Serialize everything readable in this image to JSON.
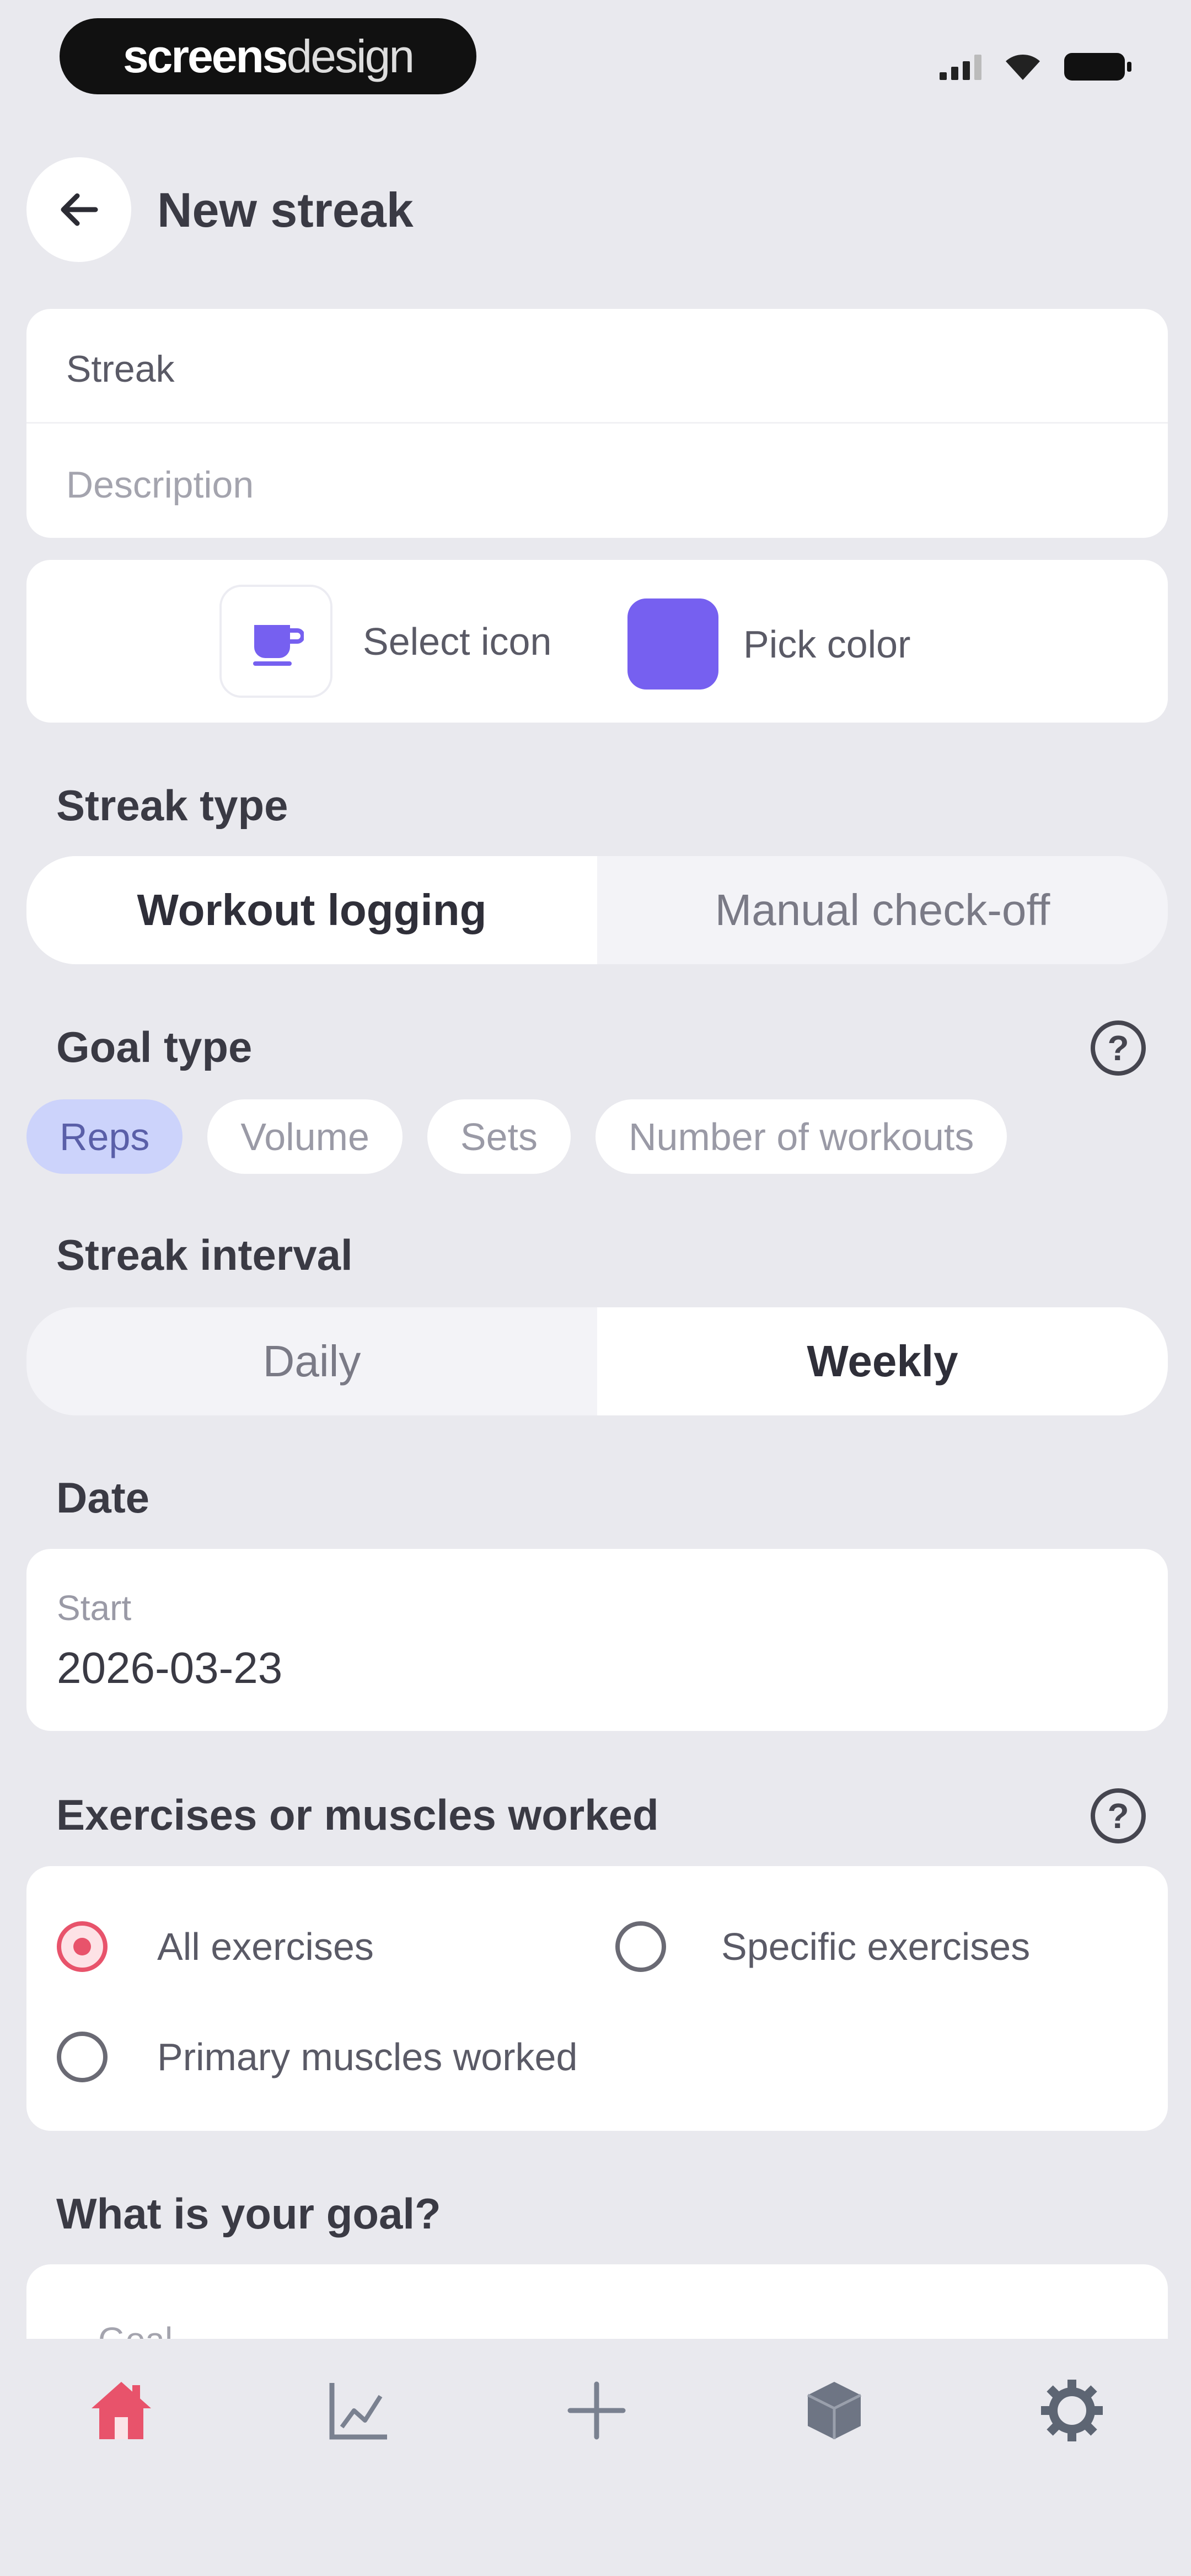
{
  "status_bar": {
    "brand_bold": "screens",
    "brand_light": "design",
    "icons": [
      "cellular-signal-icon",
      "wifi-icon",
      "battery-icon"
    ]
  },
  "header": {
    "title": "New streak",
    "back_icon": "arrow-left-icon"
  },
  "details": {
    "name_placeholder": "Streak",
    "description_placeholder": "Description"
  },
  "appearance": {
    "select_icon_label": "Select icon",
    "pick_color_label": "Pick color",
    "selected_icon": "coffee-cup-icon",
    "selected_color": "#7660f0"
  },
  "streak_type": {
    "title": "Streak type",
    "options": [
      "Workout logging",
      "Manual check-off"
    ],
    "selected": "Workout logging"
  },
  "goal_type": {
    "title": "Goal type",
    "options": [
      "Reps",
      "Volume",
      "Sets",
      "Number of workouts"
    ],
    "selected": "Reps",
    "help_icon": "question-circle-icon"
  },
  "streak_interval": {
    "title": "Streak interval",
    "options": [
      "Daily",
      "Weekly"
    ],
    "selected": "Weekly"
  },
  "date": {
    "title": "Date",
    "start_label": "Start",
    "start_value": "2026-03-23"
  },
  "exercises": {
    "title": "Exercises or muscles worked",
    "options": [
      "All exercises",
      "Specific exercises",
      "Primary muscles worked"
    ],
    "selected": "All exercises",
    "help_icon": "question-circle-icon"
  },
  "goal": {
    "title": "What is your goal?",
    "placeholder": "Goal"
  },
  "tab_bar": {
    "items": [
      "home-icon",
      "chart-icon",
      "plus-icon",
      "box-icon",
      "gear-icon"
    ],
    "active": "home-icon",
    "accent_color": "#e8536b"
  }
}
